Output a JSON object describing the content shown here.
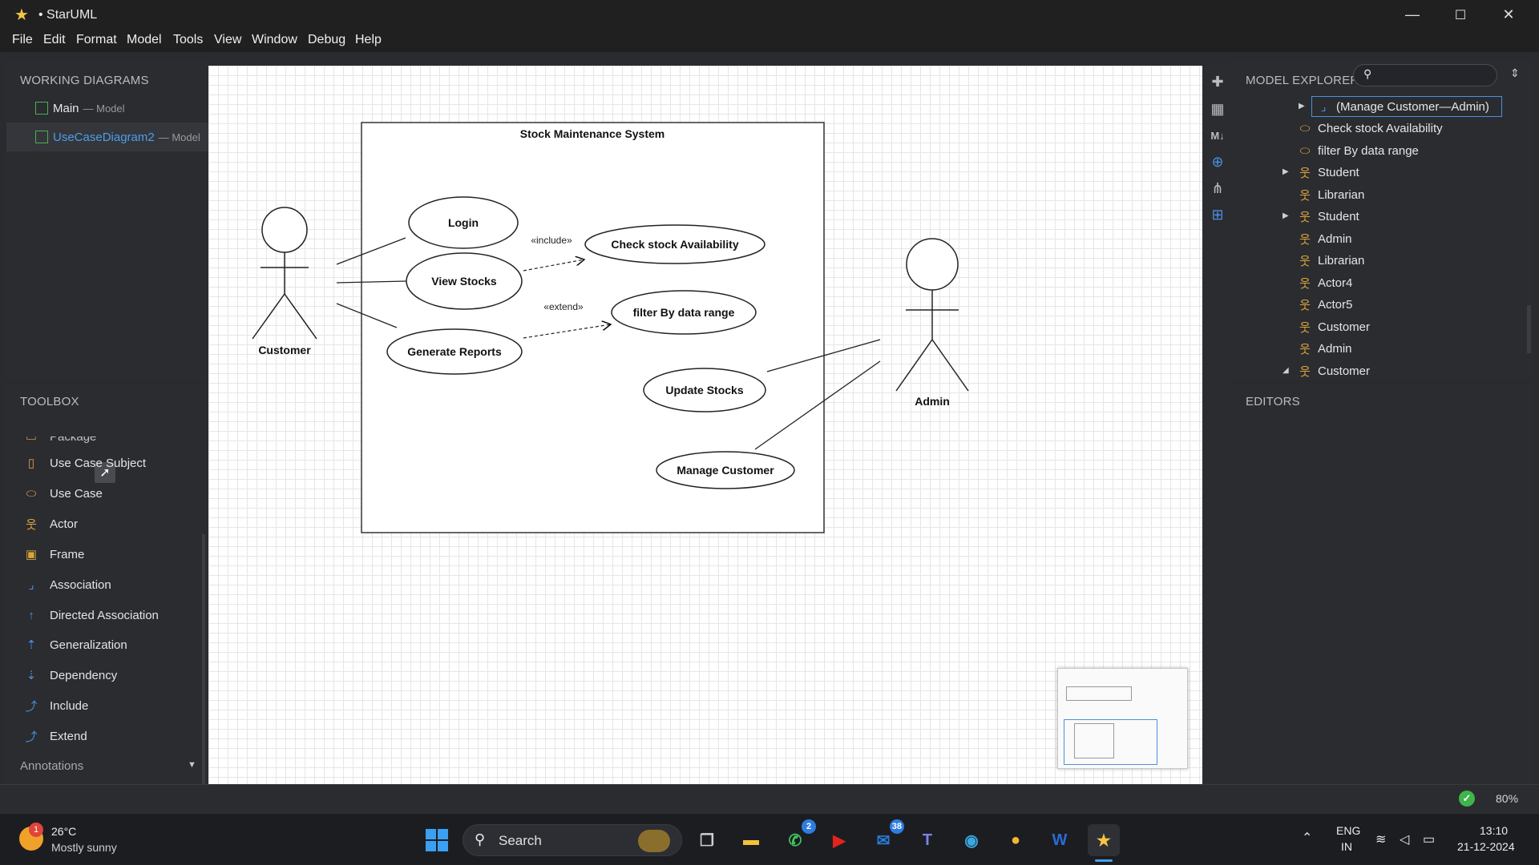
{
  "window": {
    "title": "• StarUML",
    "minimize": "—",
    "maximize": "☐",
    "close": "✕"
  },
  "menu": [
    "File",
    "Edit",
    "Format",
    "Model",
    "Tools",
    "View",
    "Window",
    "Debug",
    "Help"
  ],
  "working_diagrams": {
    "header": "WORKING DIAGRAMS",
    "items": [
      {
        "name": "Main",
        "suffix": "— Model",
        "active": false
      },
      {
        "name": "UseCaseDiagram2",
        "suffix": "— Model",
        "active": true
      }
    ]
  },
  "toolbox": {
    "header": "TOOLBOX",
    "partial_item": "Package",
    "items": [
      {
        "label": "Use Case Subject",
        "icon": "subject-icon"
      },
      {
        "label": "Use Case",
        "icon": "usecase-icon"
      },
      {
        "label": "Actor",
        "icon": "actor-icon"
      },
      {
        "label": "Frame",
        "icon": "frame-icon"
      },
      {
        "label": "Association",
        "icon": "association-icon"
      },
      {
        "label": "Directed Association",
        "icon": "directed-association-icon"
      },
      {
        "label": "Generalization",
        "icon": "generalization-icon"
      },
      {
        "label": "Dependency",
        "icon": "dependency-icon"
      },
      {
        "label": "Include",
        "icon": "include-icon"
      },
      {
        "label": "Extend",
        "icon": "extend-icon"
      }
    ],
    "section": "Annotations"
  },
  "diagram": {
    "subject_title": "Stock Maintenance System",
    "actors": {
      "customer": "Customer",
      "admin": "Admin"
    },
    "usecases": {
      "login": "Login",
      "view_stocks": "View Stocks",
      "generate_reports": "Generate Reports",
      "check_stock": "Check stock Availability",
      "filter": "filter By data range",
      "update_stocks": "Update Stocks",
      "manage_customer": "Manage Customer"
    },
    "stereotypes": {
      "include": "«include»",
      "extend": "«extend»"
    }
  },
  "model_explorer": {
    "header": "MODEL EXPLORER",
    "search_placeholder": "",
    "rows": [
      {
        "label": "(Manage Customer—Admin)",
        "icon": "association-icon",
        "expander": "collapsed",
        "selected": true
      },
      {
        "label": "Check stock Availability",
        "icon": "usecase-icon",
        "expander": "none",
        "selected": false
      },
      {
        "label": "filter By data range",
        "icon": "usecase-icon",
        "expander": "none",
        "selected": false
      },
      {
        "label": "Student",
        "icon": "actor-icon",
        "expander": "collapsed",
        "selected": false
      },
      {
        "label": "Librarian",
        "icon": "actor-icon",
        "expander": "none",
        "selected": false
      },
      {
        "label": "Student",
        "icon": "actor-icon",
        "expander": "collapsed",
        "selected": false
      },
      {
        "label": "Admin",
        "icon": "actor-icon",
        "expander": "none",
        "selected": false
      },
      {
        "label": "Librarian",
        "icon": "actor-icon",
        "expander": "none",
        "selected": false
      },
      {
        "label": "Actor4",
        "icon": "actor-icon",
        "expander": "none",
        "selected": false
      },
      {
        "label": "Actor5",
        "icon": "actor-icon",
        "expander": "none",
        "selected": false
      },
      {
        "label": "Customer",
        "icon": "actor-icon",
        "expander": "none",
        "selected": false
      },
      {
        "label": "Admin",
        "icon": "actor-icon",
        "expander": "none",
        "selected": false
      },
      {
        "label": "Customer",
        "icon": "actor-icon",
        "expander": "expanded",
        "selected": false
      }
    ]
  },
  "editors": {
    "header": "EDITORS"
  },
  "status": {
    "zoom": "80%"
  },
  "taskbar": {
    "weather_temp": "26°C",
    "weather_desc": "Mostly sunny",
    "weather_badge": "1",
    "search_label": "Search",
    "whatsapp_badge": "2",
    "outlook_badge": "38",
    "lang_top": "ENG",
    "lang_bottom": "IN",
    "time": "13:10",
    "date": "21-12-2024"
  },
  "colors": {
    "accent": "#4a90e2",
    "icon_gold": "#d8a53c",
    "active_diagram": "#4a9fe8",
    "status_ok": "#3db54a"
  }
}
